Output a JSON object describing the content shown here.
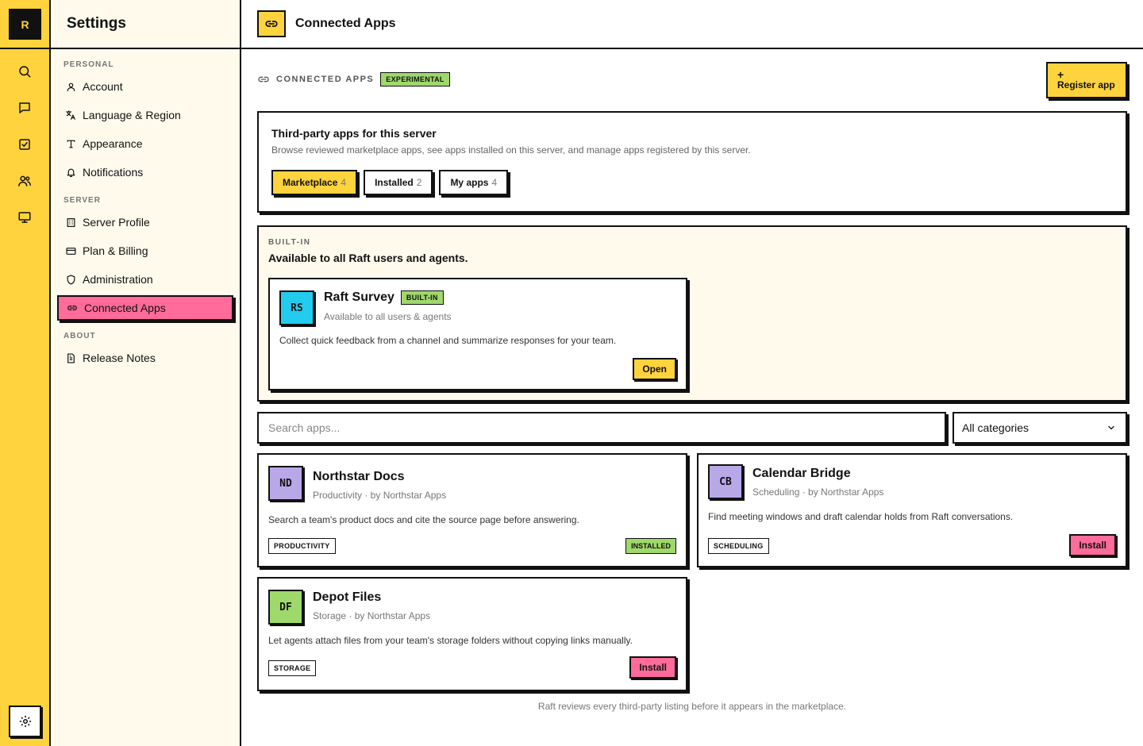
{
  "app": {
    "logo_letter": "R"
  },
  "rail": {
    "icons": [
      "search-icon",
      "chat-icon",
      "tasks-icon",
      "people-icon",
      "monitor-icon",
      "gear-icon"
    ]
  },
  "sidebar": {
    "title": "Settings",
    "groups": [
      {
        "label": "PERSONAL"
      },
      {
        "label": "SERVER"
      },
      {
        "label": "ABOUT"
      }
    ],
    "items": [
      {
        "label": "Account",
        "icon": "user-icon"
      },
      {
        "label": "Language & Region",
        "icon": "translate-icon"
      },
      {
        "label": "Appearance",
        "icon": "type-icon"
      },
      {
        "label": "Notifications",
        "icon": "bell-icon"
      },
      {
        "label": "Server Profile",
        "icon": "building-icon"
      },
      {
        "label": "Plan & Billing",
        "icon": "card-icon"
      },
      {
        "label": "Administration",
        "icon": "shield-icon"
      },
      {
        "label": "Connected Apps",
        "icon": "link-icon",
        "active": true
      },
      {
        "label": "Release Notes",
        "icon": "file-icon"
      }
    ]
  },
  "header": {
    "title": "Connected Apps"
  },
  "section": {
    "label": "CONNECTED APPS",
    "badge": "EXPERIMENTAL",
    "register_plus": "+",
    "register_label": "Register app"
  },
  "intro": {
    "title": "Third-party apps for this server",
    "description": "Browse reviewed marketplace apps, see apps installed on this server, and manage apps registered by this server.",
    "tabs": [
      {
        "label": "Marketplace",
        "count": "4",
        "active": true
      },
      {
        "label": "Installed",
        "count": "2"
      },
      {
        "label": "My apps",
        "count": "4"
      }
    ]
  },
  "builtin": {
    "label": "BUILT-IN",
    "description": "Available to all Raft users and agents.",
    "app": {
      "initials": "RS",
      "name": "Raft Survey",
      "badge": "BUILT-IN",
      "subtitle": "Available to all users & agents",
      "description": "Collect quick feedback from a channel and summarize responses for your team.",
      "action": "Open",
      "color": "#22CCEE"
    }
  },
  "search": {
    "placeholder": "Search apps..."
  },
  "category_select": {
    "value": "All categories"
  },
  "apps": [
    {
      "initials": "ND",
      "name": "Northstar Docs",
      "subtitle": "Productivity · by Northstar Apps",
      "description": "Search a team's product docs and cite the source page before answering.",
      "category": "PRODUCTIVITY",
      "status": "INSTALLED",
      "color": "#B9A8E8"
    },
    {
      "initials": "CB",
      "name": "Calendar Bridge",
      "subtitle": "Scheduling · by Northstar Apps",
      "description": "Find meeting windows and draft calendar holds from Raft conversations.",
      "category": "SCHEDULING",
      "action": "Install",
      "color": "#B9A8E8"
    },
    {
      "initials": "DF",
      "name": "Depot Files",
      "subtitle": "Storage · by Northstar Apps",
      "description": "Let agents attach files from your team's storage folders without copying links manually.",
      "category": "STORAGE",
      "action": "Install",
      "color": "#9FD86B"
    }
  ],
  "footer_note": "Raft reviews every third-party listing before it appears in the marketplace.",
  "colors": {
    "rail": "#FFD33D",
    "sidebar": "#FFFAEC",
    "active_nav": "#FF6B9A",
    "accent_yellow": "#FFD33D",
    "accent_green": "#9FD86B",
    "accent_pink": "#FF6B9A"
  }
}
